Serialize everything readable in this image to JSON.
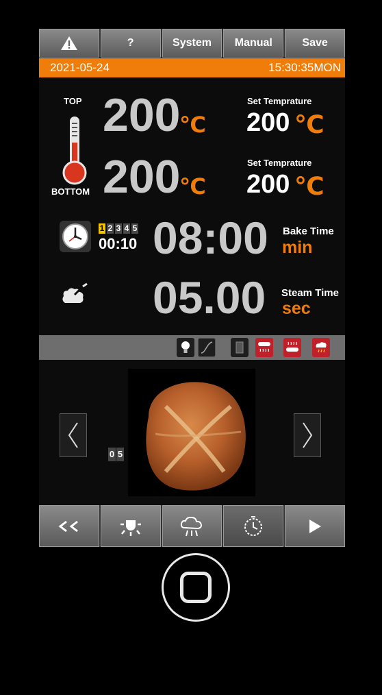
{
  "topbar": {
    "warning_label": "⚠",
    "help_label": "?",
    "system_label": "System",
    "manual_label": "Manual",
    "save_label": "Save"
  },
  "status": {
    "date": "2021-05-24",
    "time": "15:30:35MON"
  },
  "temperature": {
    "top_label": "TOP",
    "bottom_label": "BOTTOM",
    "top_value": "200",
    "bottom_value": "200",
    "unit": "℃",
    "set_label_top": "Set Temprature",
    "set_label_bottom": "Set Temprature",
    "set_top_value": "200",
    "set_bottom_value": "200"
  },
  "bake": {
    "steps": [
      "1",
      "2",
      "3",
      "4",
      "5"
    ],
    "active_step": "1",
    "step_time": "00:10",
    "value": "08:00",
    "label": "Bake Time",
    "unit": "min"
  },
  "steam": {
    "value": "05.00",
    "label": "Steam Time",
    "unit": "sec"
  },
  "recipe": {
    "number_digits": [
      "0",
      "5"
    ]
  },
  "icons": {
    "status": [
      "bulb-icon",
      "curve-icon",
      "door-icon",
      "top-heater-icon",
      "bottom-heater-icon",
      "steam-icon"
    ],
    "bottom": [
      "back-icon",
      "light-icon",
      "steam-cloud-icon",
      "timer-icon",
      "play-icon"
    ]
  },
  "colors": {
    "accent": "#f07d0a",
    "active_step": "#f5c400",
    "heater_on": "#c0202a"
  }
}
